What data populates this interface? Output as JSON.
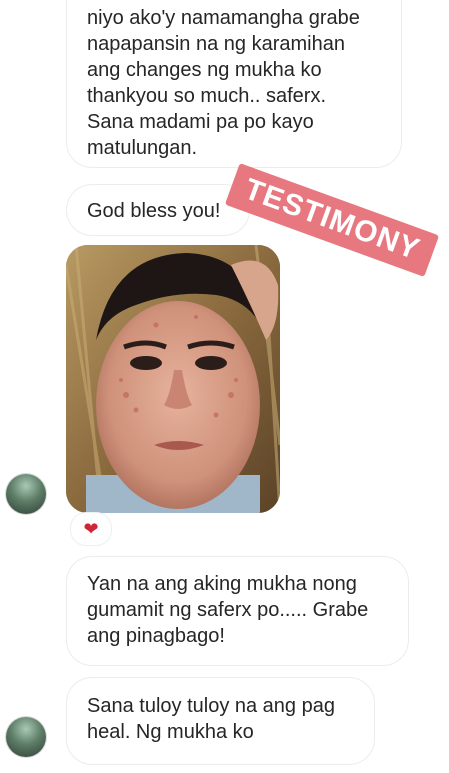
{
  "messages": [
    {
      "text": "niyo ako'y namamangha grabe\nnapapansin na ng karamihan\nang changes ng mukha ko\nthankyou so much.. saferx.\nSana madami pa po kayo\nmatulungan."
    },
    {
      "text": "God bless you!"
    },
    {
      "text": "Yan na ang aking mukha nong\ngumamit ng saferx po..... Grabe\nang pinagbago!"
    },
    {
      "text": "Sana tuloy tuloy na ang pag\nheal. Ng mukha ko"
    }
  ],
  "stamp": {
    "text": "TESTIMONY",
    "color": "#e8787f"
  },
  "reaction": {
    "icon": "heart-icon",
    "glyph": "❤",
    "color": "#d02537"
  },
  "photo": {
    "icon": "selfie-photo"
  },
  "avatar": {
    "icon": "user-avatar"
  }
}
